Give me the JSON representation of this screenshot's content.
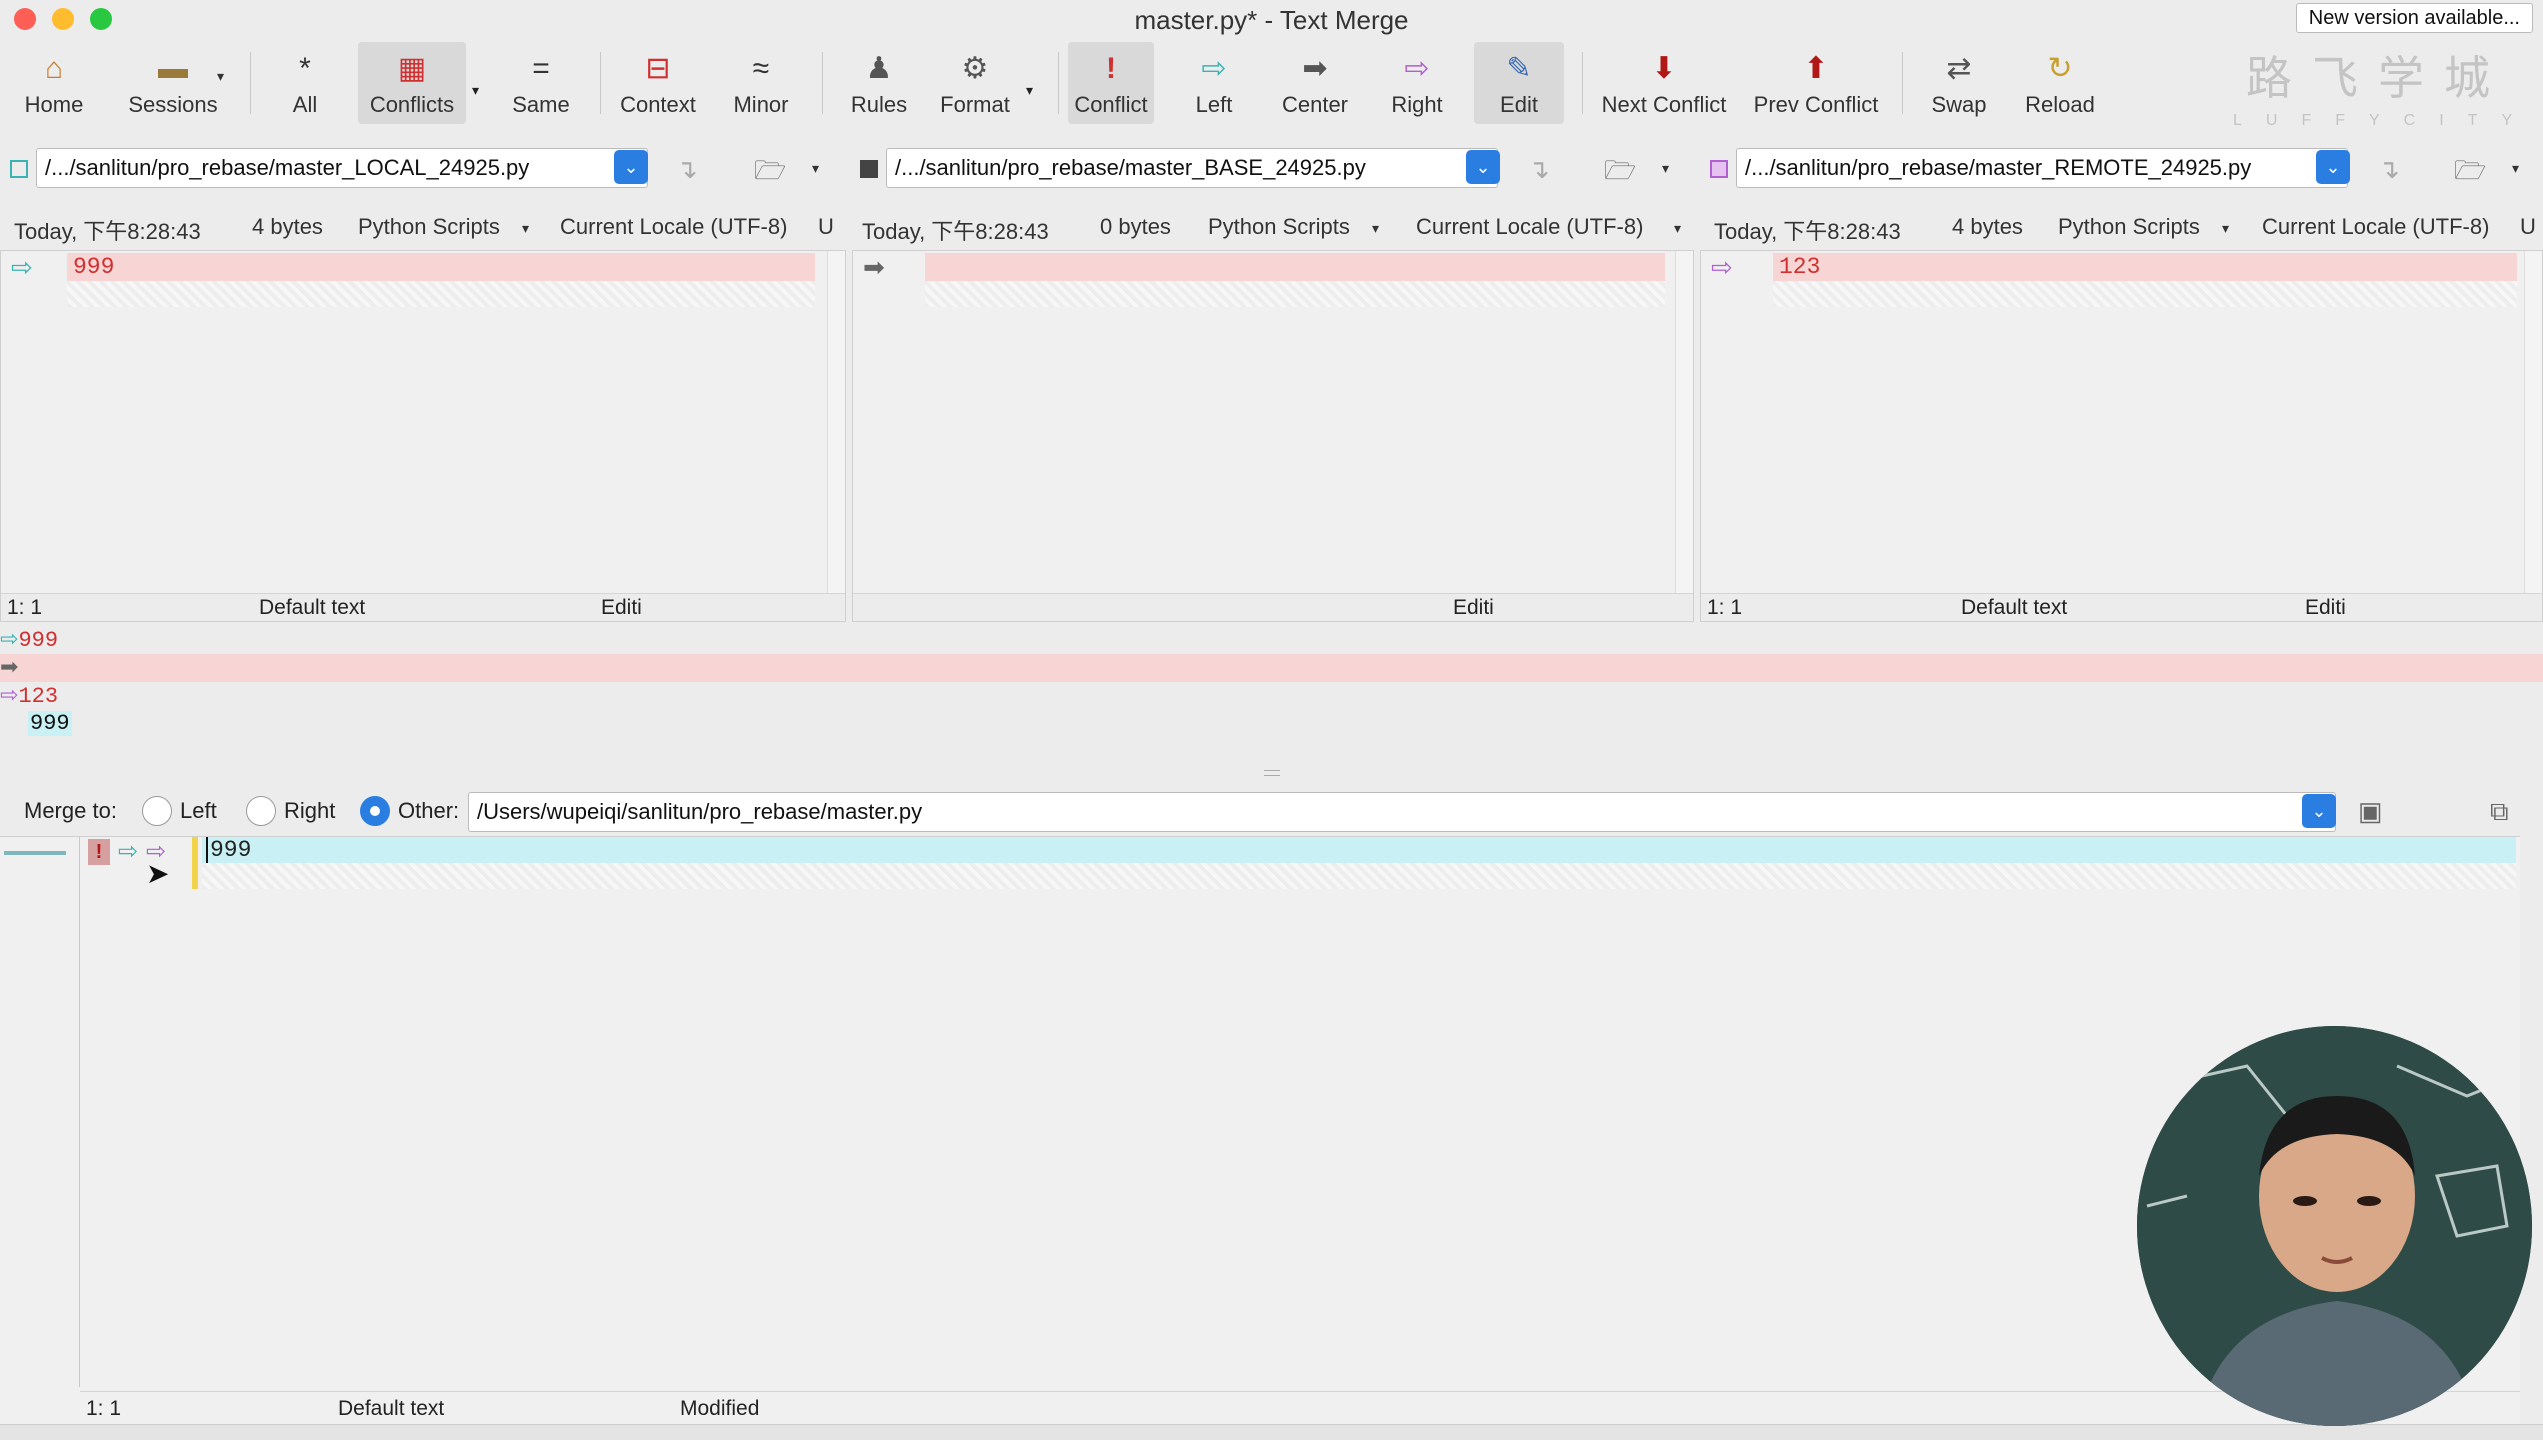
{
  "window": {
    "title": "master.py* - Text Merge",
    "new_version": "New version available..."
  },
  "toolbar": {
    "home": "Home",
    "sessions": "Sessions",
    "all": "All",
    "conflicts": "Conflicts",
    "same": "Same",
    "context": "Context",
    "minor": "Minor",
    "rules": "Rules",
    "format": "Format",
    "conflict": "Conflict",
    "left": "Left",
    "center": "Center",
    "right": "Right",
    "edit": "Edit",
    "next_conflict": "Next Conflict",
    "prev_conflict": "Prev Conflict",
    "swap": "Swap",
    "reload": "Reload"
  },
  "logo": {
    "cn": "路飞学城",
    "en": "LUFFYCITY"
  },
  "local": {
    "path": "/.../sanlitun/pro_rebase/master_LOCAL_24925.py",
    "date": "Today, 下午8:28:43",
    "size": "4 bytes",
    "format": "Python Scripts",
    "encoding": "Current Locale (UTF-8)",
    "extra": "U",
    "line": "999",
    "pos": "1: 1",
    "text_mode": "Default text",
    "edit_mode": "Editi"
  },
  "base": {
    "path": "/.../sanlitun/pro_rebase/master_BASE_24925.py",
    "date": "Today, 下午8:28:43",
    "size": "0 bytes",
    "format": "Python Scripts",
    "encoding": "Current Locale (UTF-8)",
    "line": "",
    "edit_mode": "Editi"
  },
  "remote": {
    "path": "/.../sanlitun/pro_rebase/master_REMOTE_24925.py",
    "date": "Today, 下午8:28:43",
    "size": "4 bytes",
    "format": "Python Scripts",
    "encoding": "Current Locale (UTF-8)",
    "extra": "U",
    "line": "123",
    "pos": "1: 1",
    "text_mode": "Default text",
    "edit_mode": "Editi"
  },
  "summary": {
    "local": "999",
    "remote": "123",
    "result": "999"
  },
  "merge": {
    "label": "Merge to:",
    "left": "Left",
    "right": "Right",
    "other": "Other:",
    "selected": "Other",
    "path": "/Users/wupeiqi/sanlitun/pro_rebase/master.py"
  },
  "output": {
    "line": "999",
    "pos": "1: 1",
    "text_mode": "Default text",
    "state": "Modified"
  },
  "colors": {
    "accent": "#2a7de1",
    "conflict_red": "#d03030",
    "left_teal": "#3bb3b3",
    "right_purple": "#b060d0"
  },
  "icons": [
    "home-icon",
    "sessions-icon",
    "asterisk-icon",
    "conflicts-icon",
    "equals-icon",
    "context-icon",
    "approx-icon",
    "rules-icon",
    "format-icon",
    "conflict-icon",
    "left-arrow-icon",
    "center-arrow-icon",
    "right-arrow-icon",
    "edit-icon",
    "next-conflict-icon",
    "prev-conflict-icon",
    "swap-icon",
    "reload-icon"
  ]
}
